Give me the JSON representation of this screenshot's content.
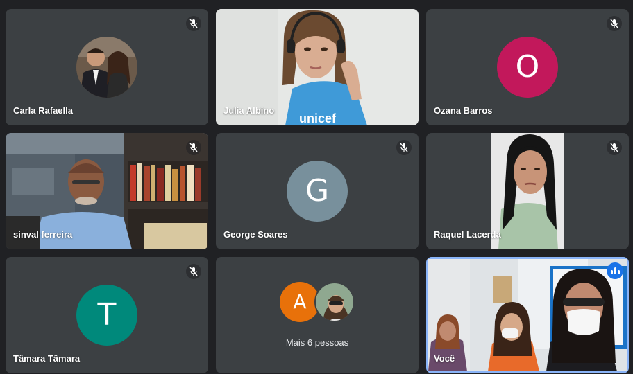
{
  "participants": [
    {
      "name": "Carla Rafaella",
      "muted": true,
      "kind": "photo-avatar"
    },
    {
      "name": "Julia Albino",
      "muted": false,
      "kind": "video",
      "shirt_text": "unicef"
    },
    {
      "name": "Ozana Barros",
      "muted": true,
      "kind": "letter-avatar",
      "initial": "O",
      "color": "#c2185b"
    },
    {
      "name": "sinval ferreira",
      "muted": true,
      "kind": "video"
    },
    {
      "name": "George Soares",
      "muted": true,
      "kind": "letter-avatar",
      "initial": "G",
      "color": "#78909c"
    },
    {
      "name": "Raquel Lacerda",
      "muted": true,
      "kind": "video"
    },
    {
      "name": "Tâmara Tâmara",
      "muted": true,
      "kind": "letter-avatar",
      "initial": "T",
      "color": "#00897b"
    },
    {
      "name": "Mais 6 pessoas",
      "kind": "overflow",
      "initial": "A",
      "color": "#e8710a"
    },
    {
      "name": "Você",
      "muted": false,
      "kind": "self-video",
      "speaking": true,
      "highlight_color": "#8ab4f8"
    }
  ],
  "colors": {
    "background": "#202124",
    "tile": "#3c4043",
    "speaking": "#1a73e8"
  }
}
